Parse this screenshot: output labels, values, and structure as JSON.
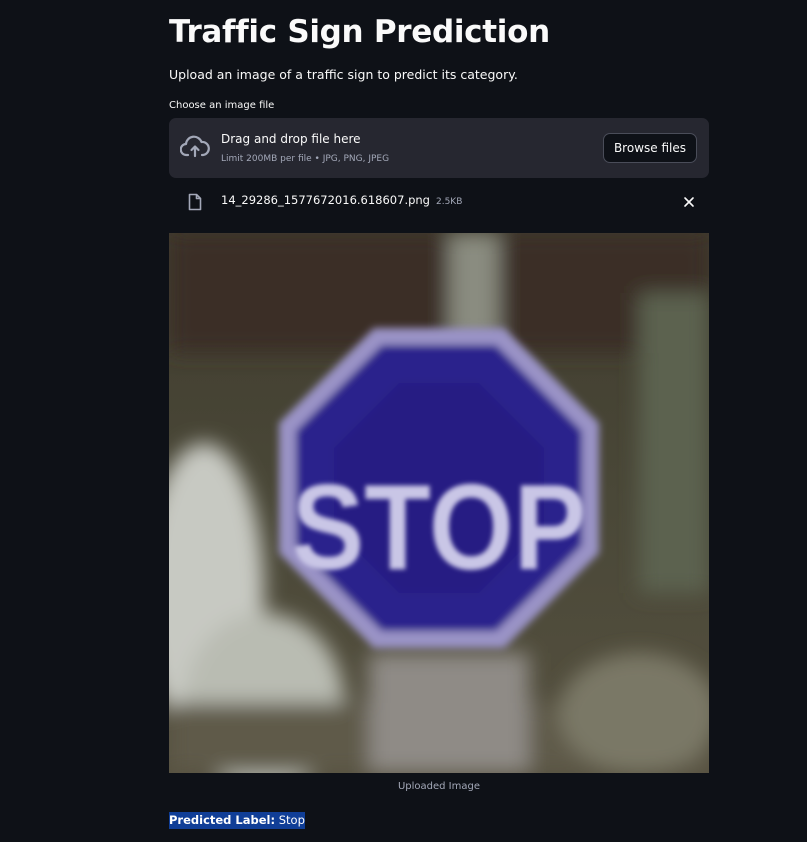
{
  "page": {
    "title": "Traffic Sign Prediction",
    "subtitle": "Upload an image of a traffic sign to predict its category."
  },
  "uploader": {
    "label": "Choose an image file",
    "drop_title": "Drag and drop file here",
    "limit_text": "Limit 200MB per file • JPG, PNG, JPEG",
    "browse_label": "Browse files",
    "icons": {
      "upload": "cloud-upload-icon",
      "file": "file-icon",
      "remove": "close-icon"
    }
  },
  "file": {
    "name": "14_29286_1577672016.618607.png",
    "size": "2.5KB"
  },
  "image": {
    "sign_text": "STOP",
    "caption": "Uploaded Image"
  },
  "prediction": {
    "label_prefix": "Predicted Label:",
    "label_value": "Stop"
  },
  "colors": {
    "background": "#0e1117",
    "dropzone": "#262730",
    "highlight": "#103e97",
    "sign": "#2a238c"
  }
}
